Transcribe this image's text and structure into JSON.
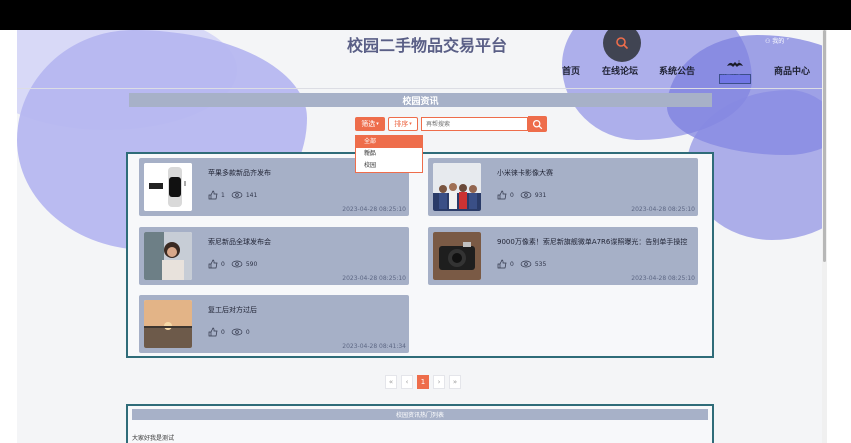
{
  "header": {
    "site_title": "校园二手物品交易平台",
    "user_label": "我的",
    "nav": [
      {
        "label": "首页"
      },
      {
        "label": "在线论坛"
      },
      {
        "label": "系统公告"
      },
      {
        "label": "校园资讯"
      },
      {
        "label": "商品中心"
      }
    ]
  },
  "section": {
    "title": "校园资讯"
  },
  "toolbar": {
    "filter_label": "筛选",
    "sort_label": "排序",
    "search_placeholder": "再帮搜索"
  },
  "filter_dropdown": {
    "options": [
      "全部",
      "新品",
      "校园"
    ],
    "selected": "全部"
  },
  "news": [
    {
      "title": "苹果多款新品齐发布",
      "likes": "1",
      "views": "141",
      "date": "2023-04-28 08:25:10"
    },
    {
      "title": "小米徕卡影像大赛",
      "likes": "0",
      "views": "931",
      "date": "2023-04-28 08:25:10"
    },
    {
      "title": "索尼新品全球发布会",
      "likes": "0",
      "views": "590",
      "date": "2023-04-28 08:25:10"
    },
    {
      "title": "9000万像素！索尼新旗舰微单A7R6谍照曝光：告别单手操控",
      "likes": "0",
      "views": "535",
      "date": "2023-04-28 08:25:10"
    },
    {
      "title": "复工后对方过后",
      "likes": "0",
      "views": "0",
      "date": "2023-04-28 08:41:34"
    }
  ],
  "pagination": {
    "first": "«",
    "prev": "‹",
    "current": "1",
    "next": "›",
    "last": "»"
  },
  "hot_section": {
    "title": "校园资讯热门列表",
    "items": [
      "大家好我是测试"
    ]
  },
  "colors": {
    "accent": "#ee6d4b",
    "card_bg": "#a6b0c7",
    "container_border": "#2f6c79",
    "active_nav": "#7176e5"
  },
  "icons": {
    "search": "search-icon",
    "like": "like-icon",
    "eye": "eye-icon",
    "caret": "chevron-down-icon"
  }
}
